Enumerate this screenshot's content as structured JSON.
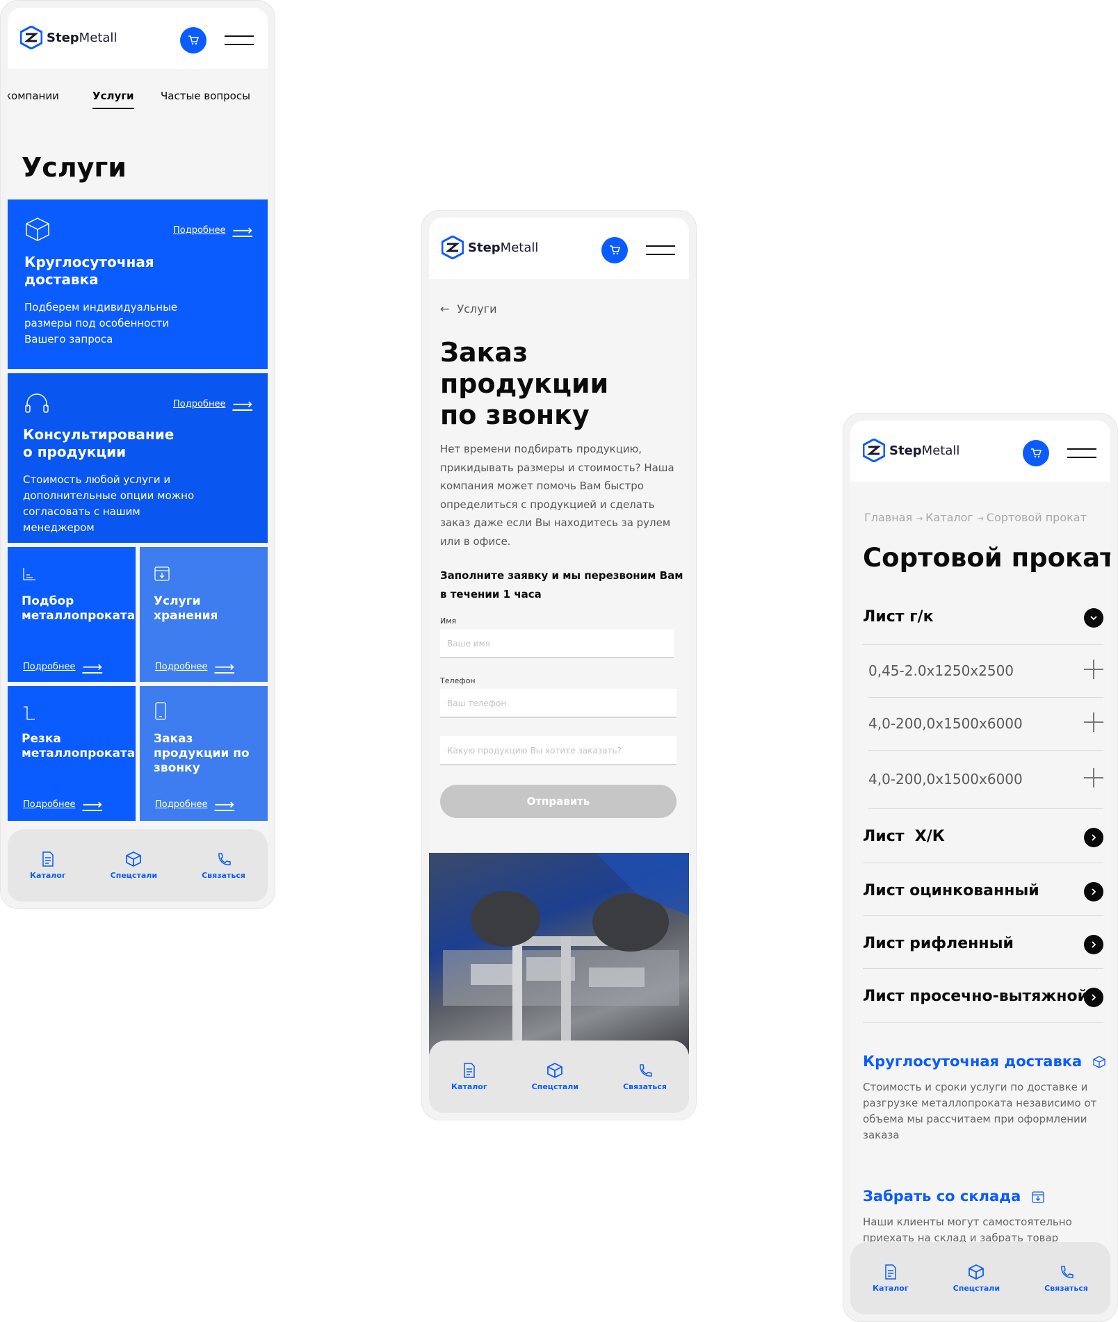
{
  "brand": {
    "bold": "Step",
    "regular": "Metall"
  },
  "tabbar": {
    "catalog": "Каталог",
    "special": "Спецстали",
    "contact": "Связаться"
  },
  "colors": {
    "accent": "#0b5cff",
    "card_light": "#3d7df0"
  },
  "phone1": {
    "subnav": [
      "компании",
      "Услуги",
      "Частые вопросы"
    ],
    "title": "Услуги",
    "more": "Подробнее",
    "cards": [
      {
        "title": "Круглосуточная доставка",
        "desc": "Подберем индивидуальные размеры под особенности Вашего запроса",
        "icon": "box-icon"
      },
      {
        "title": "Консультирование о продукции",
        "desc": "Стоимость любой услуги и дополнительные опции можно согласовать с нашим менеджером",
        "icon": "headset-icon"
      },
      {
        "title": "Подбор металлопроката",
        "icon": "chart-icon"
      },
      {
        "title": "Услуги хранения",
        "icon": "storage-icon"
      },
      {
        "title": "Резка металлопроката",
        "icon": "cut-icon"
      },
      {
        "title": "Заказ продукции по звонку",
        "icon": "phone-icon"
      }
    ]
  },
  "phone2": {
    "back": "Услуги",
    "title_lines": [
      "Заказ",
      "продукции",
      "по звонку"
    ],
    "intro": "Нет времени подбирать продукцию, прикидывать размеры и стоимость? Наша компания может помочь Вам быстро определиться с продукцией и сделать заказ даже если Вы находитесь за рулем или в офисе.",
    "form_title": "Заполните заявку и мы перезвоним Вам в течении 1 часа",
    "name_label": "Имя",
    "name_placeholder": "Ваше имя",
    "phone_label": "Телефон",
    "phone_placeholder": "Ваш телефон",
    "product_placeholder": "Какую продукцию Вы хотите заказать?",
    "submit": "Отправить"
  },
  "phone3": {
    "breadcrumb": [
      "Главная",
      "Каталог",
      "Сортовой прокат"
    ],
    "title": "Сортовой прокат",
    "group_open": "Лист г/к",
    "sub_items": [
      "0,45-2.0x1250x2500",
      "4,0-200,0x1500x6000",
      "4,0-200,0x1500x6000"
    ],
    "groups": [
      "Лист  Х/К",
      "Лист оцинкованный",
      "Лист рифленный",
      "Лист просечно-вытяжной"
    ],
    "delivery_title": "Круглосуточная доставка",
    "delivery_text": "Стоимость и сроки услуги по доставке и разгрузке металлопроката независимо от объема мы рассчитаем при оформлении заказа",
    "pickup_title": "Забрать со склада",
    "pickup_text": "Наши клиенты могут самостоятельно приехать на склад и забрать товар"
  }
}
